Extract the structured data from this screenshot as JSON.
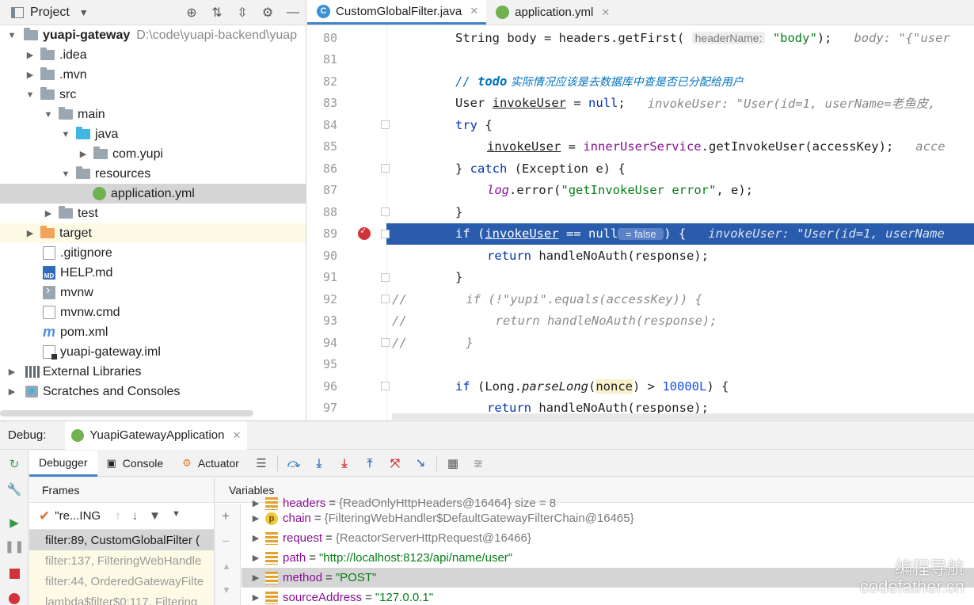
{
  "project": {
    "title": "Project",
    "tree": [
      {
        "label": "yuapi-gateway",
        "path": "D:\\code\\yuapi-backend\\yuap",
        "icon": "module-folder-icon"
      },
      {
        "label": ".idea",
        "icon": "folder-icon"
      },
      {
        "label": ".mvn",
        "icon": "folder-icon"
      },
      {
        "label": "src",
        "icon": "folder-icon"
      },
      {
        "label": "main",
        "icon": "folder-icon"
      },
      {
        "label": "java",
        "icon": "source-folder-icon"
      },
      {
        "label": "com.yupi",
        "icon": "package-icon"
      },
      {
        "label": "resources",
        "icon": "resources-folder-icon"
      },
      {
        "label": "application.yml",
        "icon": "yml-file-icon"
      },
      {
        "label": "test",
        "icon": "folder-icon"
      },
      {
        "label": "target",
        "icon": "excluded-folder-icon"
      },
      {
        "label": ".gitignore",
        "icon": "file-icon"
      },
      {
        "label": "HELP.md",
        "icon": "markdown-file-icon"
      },
      {
        "label": "mvnw",
        "icon": "script-file-icon"
      },
      {
        "label": "mvnw.cmd",
        "icon": "file-icon"
      },
      {
        "label": "pom.xml",
        "icon": "maven-file-icon"
      },
      {
        "label": "yuapi-gateway.iml",
        "icon": "iml-file-icon"
      },
      {
        "label": "External Libraries",
        "icon": "library-icon"
      },
      {
        "label": "Scratches and Consoles",
        "icon": "scratches-icon"
      }
    ]
  },
  "editor": {
    "tabs": [
      {
        "label": "CustomGlobalFilter.java",
        "icon": "java-class-icon"
      },
      {
        "label": "application.yml",
        "icon": "yml-file-icon"
      }
    ],
    "lines": {
      "l80": {
        "num": "80",
        "a": "String body = headers.",
        "b": "getFirst",
        "c": "( ",
        "param": "headerName:",
        "d": " ",
        "str": "\"body\"",
        "e": ");",
        "hint": "   body: \"{\"user"
      },
      "l81": {
        "num": "81"
      },
      "l82": {
        "num": "82",
        "cmt": "// ",
        "todo": "todo",
        "cn": " 实际情况应该是去数据库中查是否已分配给用户"
      },
      "l83": {
        "num": "83",
        "a": "User ",
        "var": "invokeUser",
        "b": " = ",
        "kw": "null",
        "c": ";",
        "hint": "   invokeUser: \"User(id=1, userName=老鱼皮, "
      },
      "l84": {
        "num": "84",
        "kw": "try",
        "a": " {"
      },
      "l85": {
        "num": "85",
        "var": "invokeUser",
        "a": " = ",
        "fld": "innerUserService",
        "b": ".",
        "call": "getInvokeUser",
        "c": "(accessKey);",
        "hint": "   acce"
      },
      "l86": {
        "num": "86",
        "a": "} ",
        "kw": "catch",
        "b": " (Exception e) {"
      },
      "l87": {
        "num": "87",
        "fld": "log",
        "a": ".",
        "call": "error",
        "b": "(",
        "str": "\"getInvokeUser error\"",
        "c": ", e);"
      },
      "l88": {
        "num": "88",
        "a": "}"
      },
      "l89": {
        "num": "89",
        "kw": "if",
        "a": " (",
        "var": "invokeUser",
        "b": " == null",
        "pill": " = false ",
        "c": ") {",
        "hint": "   invokeUser: \"User(id=1, userName"
      },
      "l90": {
        "num": "90",
        "kw": "return",
        "a": " handleNoAuth(response);"
      },
      "l91": {
        "num": "91",
        "a": "}"
      },
      "l92": {
        "num": "92",
        "cmt": "//        if (!\"yupi\".equals(accessKey)) {"
      },
      "l93": {
        "num": "93",
        "cmt": "//            return handleNoAuth(response);"
      },
      "l94": {
        "num": "94",
        "cmt": "//        }"
      },
      "l95": {
        "num": "95"
      },
      "l96": {
        "num": "96",
        "kw": "if",
        "a": " (Long.",
        "static": "parseLong",
        "b": "(",
        "nonce": "nonce",
        "c": ") > ",
        "number": "10000L",
        "d": ") {"
      },
      "l97": {
        "num": "97",
        "kw": "return",
        "a": " handleNoAuth(response);"
      }
    }
  },
  "debug": {
    "label": "Debug:",
    "run_tab": "YuapiGatewayApplication",
    "tabs": {
      "debugger": "Debugger",
      "console": "Console",
      "actuator": "Actuator"
    },
    "frames": {
      "header": "Frames",
      "thread": "\"re...ING",
      "rows": [
        "filter:89, CustomGlobalFilter (",
        "filter:137, FilteringWebHandle",
        "filter:44, OrderedGatewayFilte",
        "lambda$filter$0:117, Filtering"
      ]
    },
    "variables": {
      "header": "Variables",
      "rows": [
        {
          "name": "headers",
          "value": "{ReadOnlyHttpHeaders@16464}  size = 8",
          "icon": "field-icon"
        },
        {
          "name": "chain",
          "value": "{FilteringWebHandler$DefaultGatewayFilterChain@16465}",
          "icon": "parameter-icon",
          "badge": "p"
        },
        {
          "name": "request",
          "value": "{ReactorServerHttpRequest@16466}",
          "icon": "field-icon"
        },
        {
          "name": "path",
          "value": "\"http://localhost:8123/api/name/user\"",
          "icon": "field-icon"
        },
        {
          "name": "method",
          "value": "\"POST\"",
          "icon": "field-icon"
        },
        {
          "name": "sourceAddress",
          "value": "\"127.0.0.1\"",
          "icon": "field-icon"
        }
      ],
      "equals": "="
    }
  },
  "watermark": {
    "line1": "编程导航",
    "line2": "codefather.cn"
  },
  "colors": {
    "selection": "#2a5cad",
    "breakpoint": "#d0343a",
    "tab_underline": "#4083c9",
    "keyword": "#0033b3",
    "string": "#067d17"
  }
}
